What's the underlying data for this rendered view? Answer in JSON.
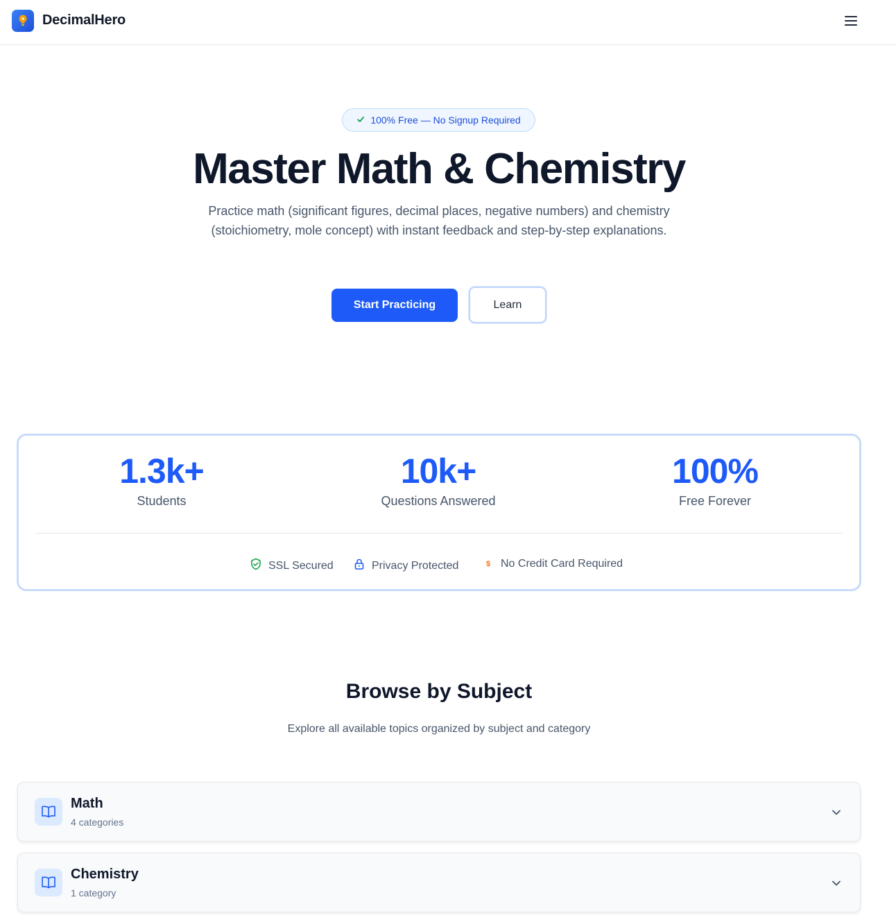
{
  "header": {
    "brand": "DecimalHero",
    "logo_icon": "lightbulb-logo-icon",
    "menu_icon": "hamburger-menu-icon"
  },
  "hero": {
    "badge_icon": "check-icon",
    "badge": "100% Free — No Signup Required",
    "title": "Master Math & Chemistry",
    "subtitle": "Practice math (significant figures, decimal places, negative numbers) and chemistry (stoichiometry, mole concept) with instant feedback and step-by-step explanations.",
    "primary_button": "Start Practicing",
    "secondary_button": "Learn"
  },
  "stats": {
    "items": [
      {
        "value": "1.3k+",
        "label": "Students"
      },
      {
        "value": "10k+",
        "label": "Questions Answered"
      },
      {
        "value": "100%",
        "label": "Free Forever"
      }
    ],
    "trust": [
      {
        "icon": "shield-check-icon",
        "label": "SSL Secured"
      },
      {
        "icon": "lock-icon",
        "label": "Privacy Protected"
      },
      {
        "icon": "dollar-icon",
        "label": "No Credit Card Required"
      }
    ]
  },
  "browse": {
    "title": "Browse by Subject",
    "subtitle": "Explore all available topics organized by subject and category",
    "subjects": [
      {
        "name": "Math",
        "count": "4 categories",
        "icon": "book-open-icon"
      },
      {
        "name": "Chemistry",
        "count": "1 category",
        "icon": "book-open-icon"
      }
    ]
  },
  "colors": {
    "accent": "#1d5af7",
    "heading": "#0f172a",
    "muted": "#475569",
    "success": "#16a34a",
    "warning": "#f97316"
  }
}
